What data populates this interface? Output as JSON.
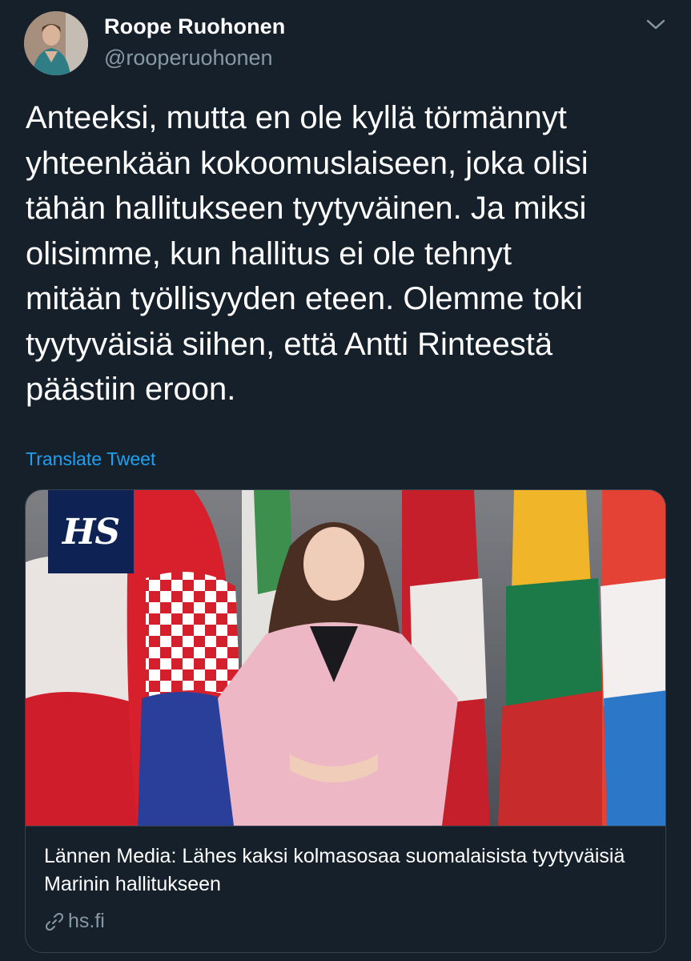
{
  "author": {
    "display_name": "Roope Ruohonen",
    "handle": "@rooperuohonen"
  },
  "tweet": {
    "text": "Anteeksi, mutta en ole kyllä törmännyt\nyhteenkään kokoomuslaiseen, joka olisi\ntähän hallitukseen tyytyväinen. Ja miksi\nolisimme, kun hallitus ei ole tehnyt\nmitään työllisyyden eteen. Olemme toki\ntyytyväisiä siihen, että Antti Rinteestä\npäästiin eroon.",
    "translate_label": "Translate Tweet"
  },
  "link_card": {
    "badge_text": "HS",
    "title": "Lännen Media: Lähes kaksi kolmasosaa suomalaisista tyytyväisiä Marinin hallitukseen",
    "domain": "hs.fi"
  },
  "icons": {
    "menu": "chevron-down-icon",
    "link": "link-icon"
  },
  "colors": {
    "background": "#15202b",
    "secondary_text": "#8899a6",
    "accent": "#1da1f2",
    "border": "#38444d",
    "hs_badge": "#0e2254"
  }
}
